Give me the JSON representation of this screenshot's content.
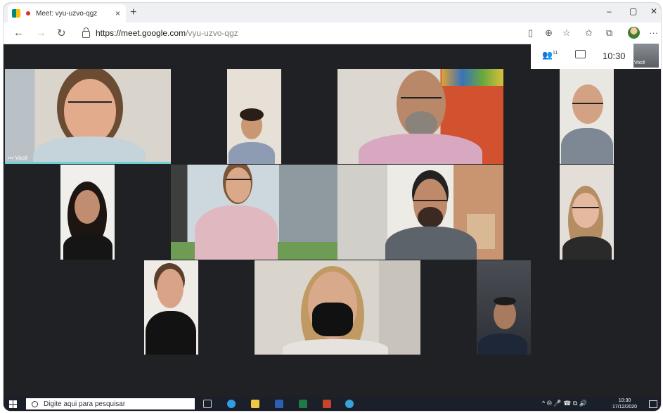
{
  "browser": {
    "tab_title": "Meet: vyu-uzvo-qgz",
    "tab_close": "×",
    "new_tab": "+",
    "window_controls": [
      "–",
      "▢",
      "✕"
    ],
    "url_host": "https://meet.google.com",
    "url_path": "/vyu-uzvo-qgz",
    "icons": [
      "back-icon",
      "forward-icon",
      "refresh-icon",
      "lock-icon",
      "extensions-icon",
      "zoom-icon",
      "favorite-icon",
      "favorites-bar-icon",
      "collections-icon",
      "profile-icon",
      "more-icon"
    ],
    "more": "···"
  },
  "meet": {
    "participant_count": "11",
    "time": "10:30",
    "self_label": "Você",
    "pinned_label": "••• Você"
  },
  "taskbar": {
    "search_placeholder": "Digite aqui para pesquisar",
    "tray_time": "10:30",
    "tray_date": "17/12/2020",
    "tray_symbols": "^ ⦾ 🎤 ☎ ⧉ 🔊"
  },
  "colors": {
    "meet_background": "#202124",
    "speaker_highlight": "#6fcfd6",
    "taskbar": "#1b1f29"
  }
}
